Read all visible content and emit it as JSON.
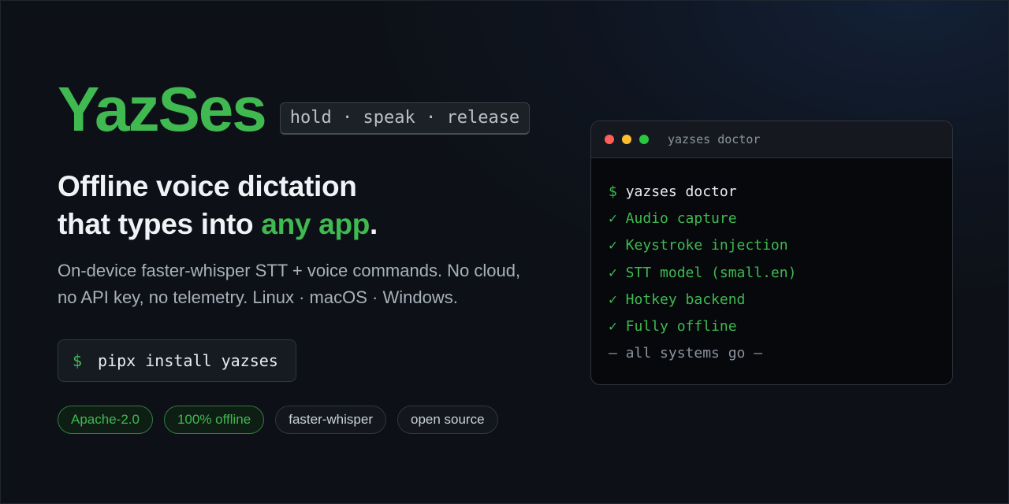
{
  "brand": {
    "title": "YazSes",
    "tagline": "hold · speak · release"
  },
  "headline": {
    "line1": "Offline voice dictation",
    "line2_prefix": "that types into ",
    "line2_accent": "any app",
    "line2_suffix": "."
  },
  "subheading": {
    "line1": "On-device faster-whisper STT + voice commands. No cloud,",
    "line2": "no API key, no telemetry. Linux · macOS · Windows."
  },
  "install": {
    "prompt": "$",
    "command": "pipx install yazses"
  },
  "badges": [
    {
      "label": "Apache-2.0",
      "style": "green"
    },
    {
      "label": "100% offline",
      "style": "green"
    },
    {
      "label": "faster-whisper",
      "style": "gray"
    },
    {
      "label": "open source",
      "style": "gray"
    }
  ],
  "terminal": {
    "title": "yazses doctor",
    "prompt": "$",
    "command": "yazses doctor",
    "checks": [
      "✓ Audio capture",
      "✓ Keystroke injection",
      "✓ STT model (small.en)",
      "✓ Hotkey backend",
      "✓ Fully offline"
    ],
    "footer": "— all systems go —"
  },
  "colors": {
    "accent": "#3fb950",
    "background": "#0d1117",
    "dot_red": "#ff5f56",
    "dot_yellow": "#ffbd2e",
    "dot_green": "#27c93f"
  }
}
